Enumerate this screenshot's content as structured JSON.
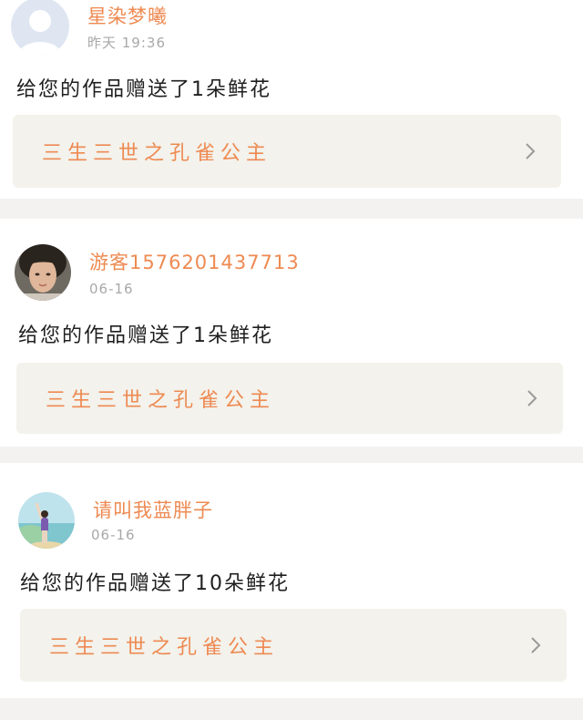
{
  "colors": {
    "accent": "#ee8a52",
    "text": "#1f1f1f",
    "muted": "#a8a8a8",
    "box_bg": "#f3f2ec",
    "page_bg": "#f3f2f0"
  },
  "notifications": [
    {
      "username": "星染梦曦",
      "time": "昨天 19:36",
      "message": "给您的作品赠送了1朵鲜花",
      "work_title": "三生三世之孔雀公主",
      "avatar": "default-user-avatar",
      "chevron_icon": "chevron-right-icon"
    },
    {
      "username": "游客1576201437713",
      "time": "06-16",
      "message": "给您的作品赠送了1朵鲜花",
      "work_title": "三生三世之孔雀公主",
      "avatar": "photo-avatar-woman",
      "chevron_icon": "chevron-right-icon"
    },
    {
      "username": "请叫我蓝胖子",
      "time": "06-16",
      "message": "给您的作品赠送了10朵鲜花",
      "work_title": "三生三世之孔雀公主",
      "avatar": "photo-avatar-beach",
      "chevron_icon": "chevron-right-icon"
    }
  ]
}
